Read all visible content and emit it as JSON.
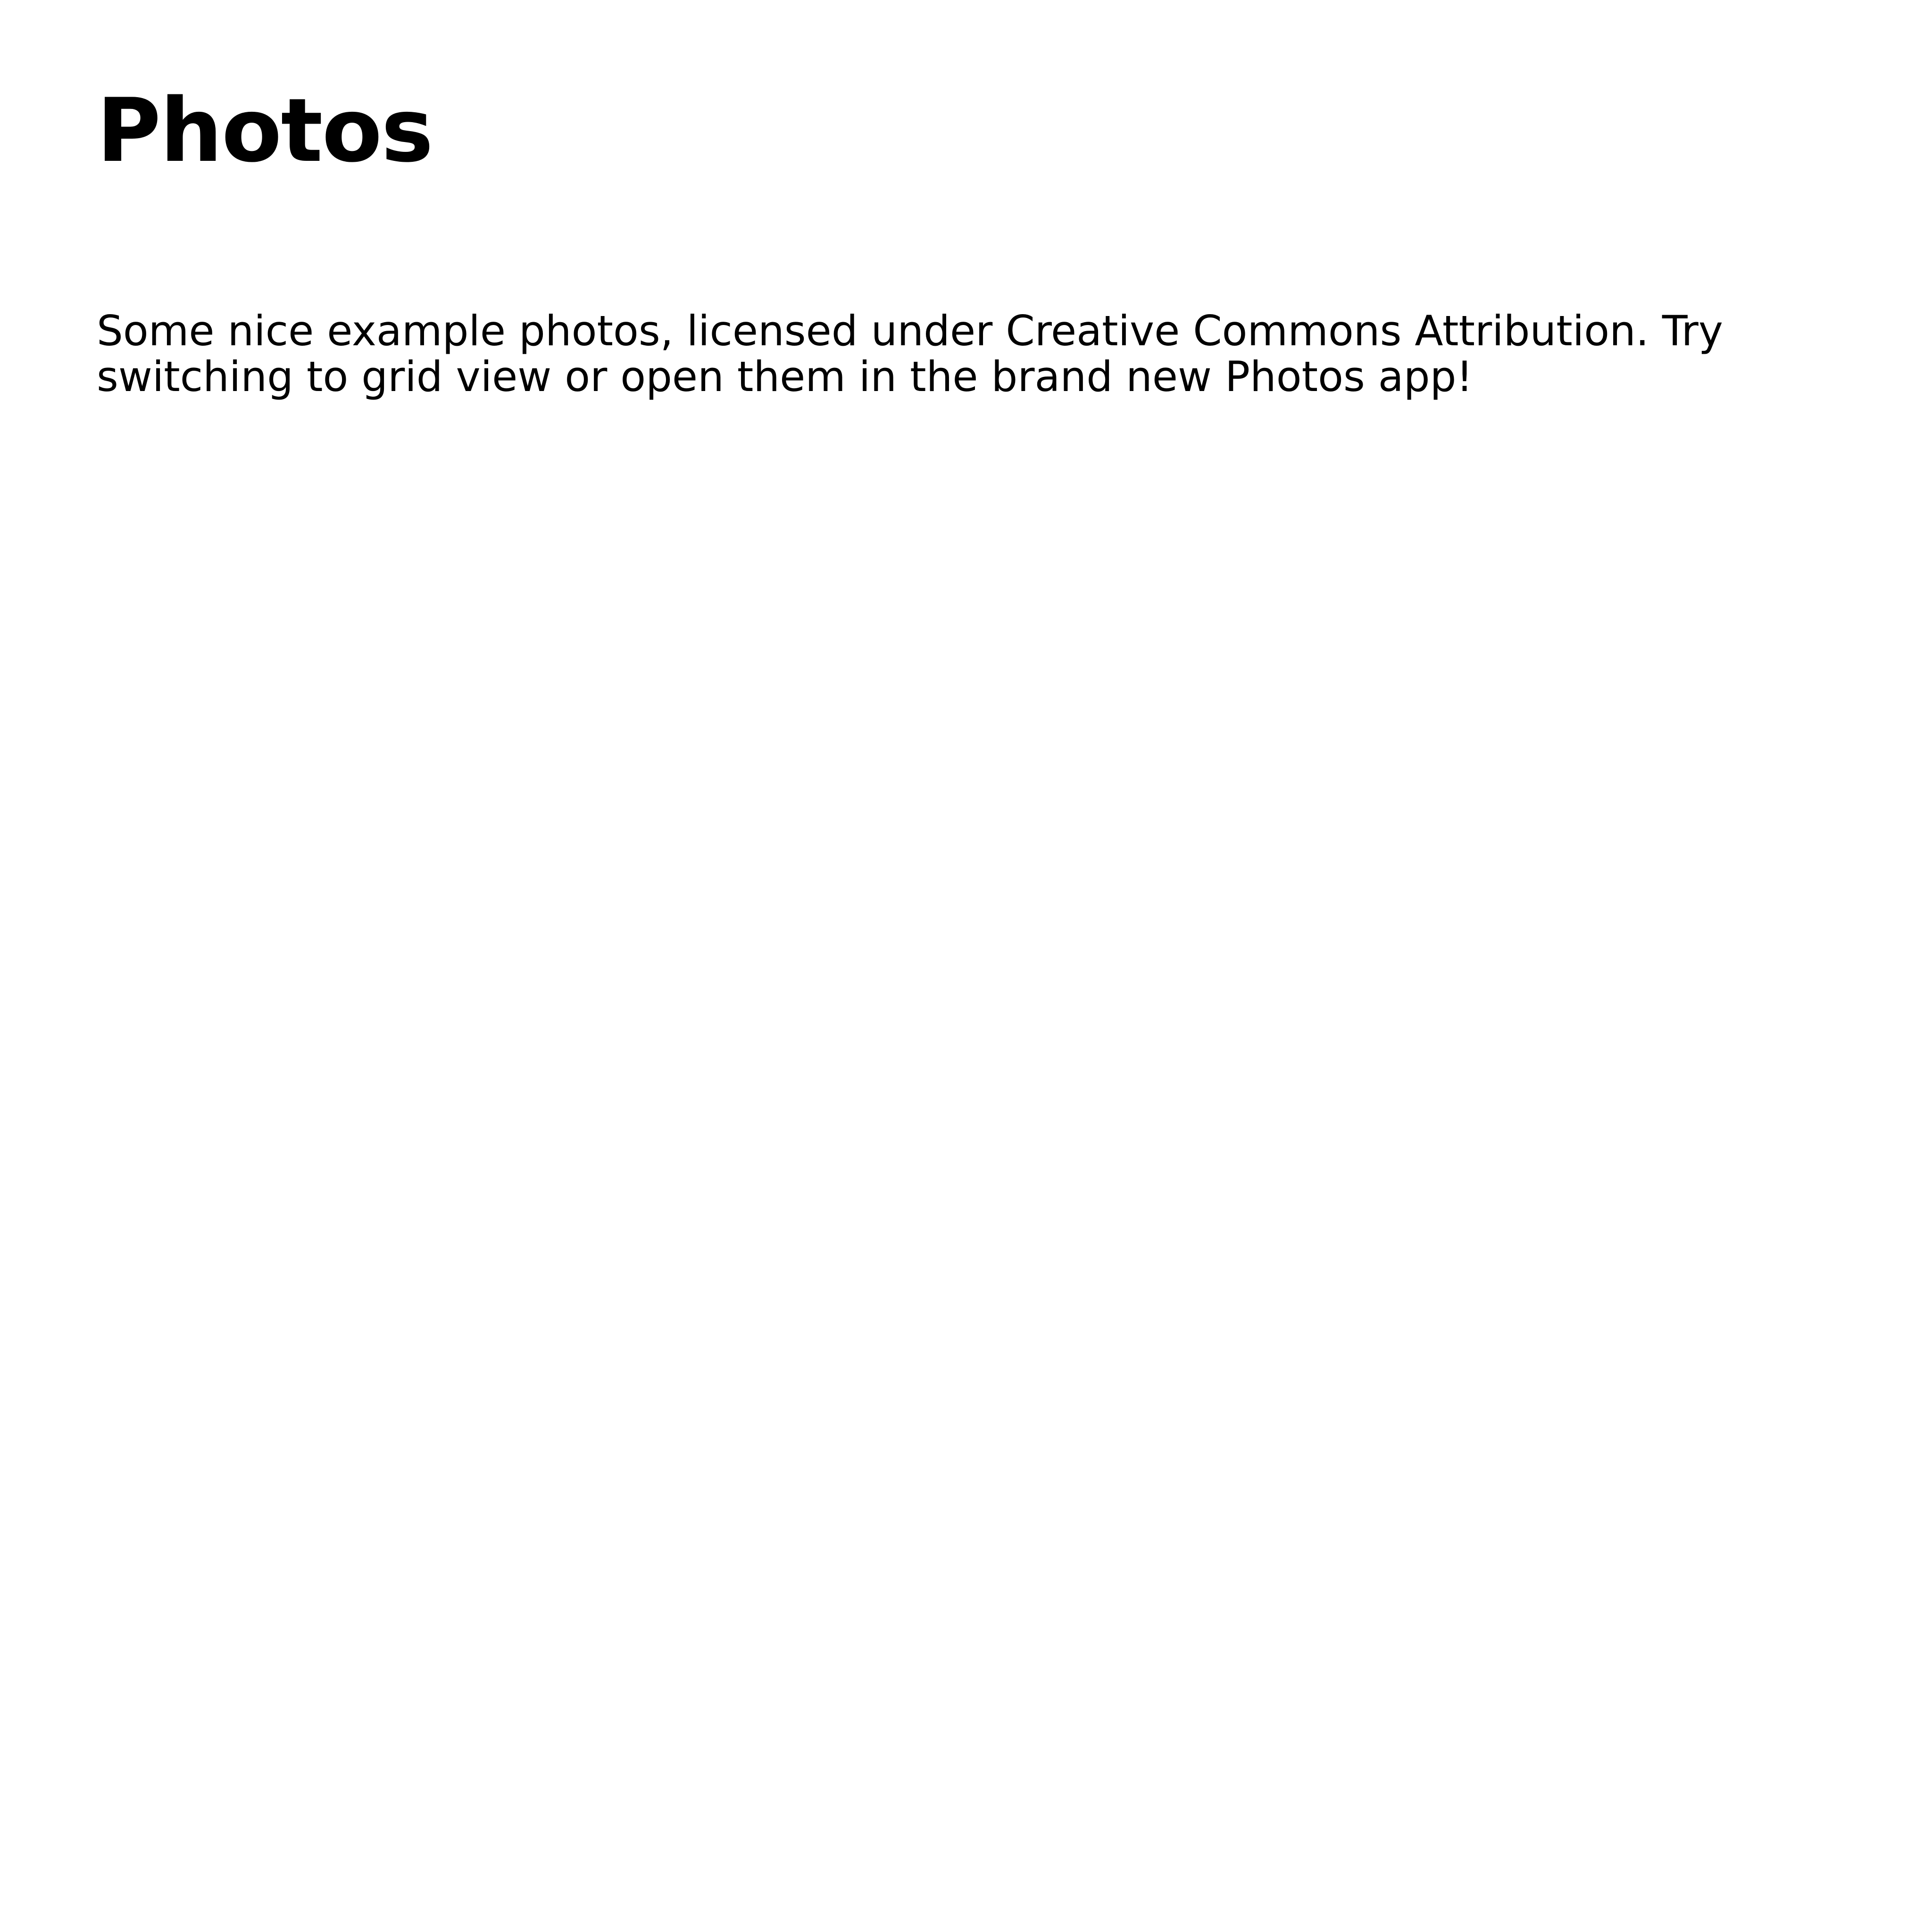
{
  "document": {
    "title": "Photos",
    "description": "Some nice example photos, licensed under Creative Commons Attribution. Try switching to grid view or open them in the brand new Photos app!"
  },
  "colors": {
    "background": "#ffffff",
    "text": "#000000"
  }
}
